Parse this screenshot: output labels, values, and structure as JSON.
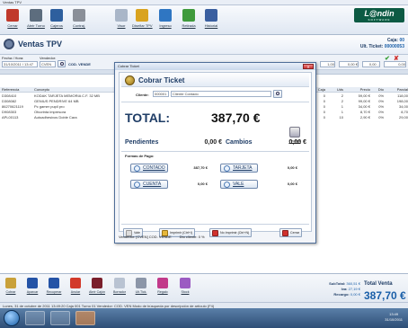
{
  "window": {
    "title": "Ventas TPV"
  },
  "toolbar": {
    "items": [
      {
        "label": "Cerrar",
        "icon": "red-circle-icon",
        "color": "#c0392b"
      },
      {
        "label": "Abrir Turno",
        "icon": "turn-icon",
        "color": "#5d6d7e"
      },
      {
        "label": "Cajeros",
        "icon": "cashier-icon",
        "color": "#2e5f9e"
      },
      {
        "label": "Contraj.",
        "icon": "person-icon",
        "color": "#8a8f98"
      },
      {
        "label": "Visor",
        "icon": "monitor-icon",
        "color": "#a9b6c8"
      },
      {
        "label": "Diseñar TPV",
        "icon": "design-icon",
        "color": "#d9a31f"
      },
      {
        "label": "Ingreso",
        "icon": "cash-in-icon",
        "color": "#2f76c2"
      },
      {
        "label": "Retirada",
        "icon": "cash-out-icon",
        "color": "#3f9a3c"
      },
      {
        "label": "Historial",
        "icon": "history-icon",
        "color": "#3a5fa0"
      }
    ]
  },
  "logo": {
    "text": "L@ndin",
    "sub": "SOFTWARE"
  },
  "header": {
    "title": "Ventas TPV",
    "caja_label": "Caja:",
    "caja_value": "00",
    "ticket_label": "Ult. Ticket:",
    "ticket_value": "00000053"
  },
  "filter": {
    "fecha_label": "Fecha / Hora:",
    "fecha_value": "31/10/2011 / 13:47",
    "vendedor_label": "Vendedor:",
    "vendedor_value": "CVEN",
    "cod_label": "COD. VENDE",
    "right_values": [
      "1,00",
      "0,00 €",
      "0,00 ..",
      "0,00"
    ]
  },
  "grid": {
    "headers": [
      "Referencia",
      "Concepto",
      "Caja",
      "Uds",
      "Precio",
      "Dto",
      "Parcial"
    ],
    "rows": [
      [
        "D308410",
        "KODAK TARJETA MEMORIA C.F. 32 MB",
        "0",
        "2",
        "59,00 €",
        "0%",
        "118,00"
      ],
      [
        "D308082",
        "GENIUS PENDRIVE 64 MB",
        "0",
        "2",
        "99,00 €",
        "0%",
        "198,00"
      ],
      [
        "86270621119",
        "Pc gamer pupil pro",
        "0",
        "1",
        "34,00 €",
        "0%",
        "34,00"
      ],
      [
        "D908303",
        "Ofcorinta impresora",
        "0",
        "1",
        "8,70 €",
        "0%",
        "8,70"
      ],
      [
        "APL00113",
        "Autoadhesivos Doble Cara",
        "0",
        "10",
        "2,90 €",
        "0%",
        "29,00"
      ]
    ]
  },
  "dialog": {
    "caption": "Cobrar Ticket",
    "title": "Cobrar Ticket",
    "cliente_label": "Cliente:",
    "cliente_code": "000001",
    "cliente_name": "Cliente Contado",
    "total_label": "TOTAL:",
    "total_value": "387,70 €",
    "fechas_label": "Fechas",
    "pendientes_label": "Pendientes",
    "pendientes_value": "0,00 €",
    "cambios_label": "Cambios",
    "cambios_value": "0,00 €",
    "formas_label": "Formas de Pago:",
    "payments": [
      {
        "label": "CONTADO",
        "value": "387,70 €"
      },
      {
        "label": "TARJETA",
        "value": "0,00 €"
      },
      {
        "label": "CUENTA",
        "value": "0,00 €"
      },
      {
        "label": "VALE",
        "value": "0,00 €"
      }
    ],
    "buttons": [
      "Vale",
      "Imprimir (Ctrl+I)",
      "No Imprimir (Ctrl+N)",
      "Cerrar"
    ],
    "footer_vendedor": "Vendedor: [CVEN] COD. VENDE",
    "footer_dto": "Dto cliente: 0 %"
  },
  "bottom": {
    "items": [
      {
        "label": "Cobrar",
        "icon": "coins-icon",
        "color": "#c9a13a"
      },
      {
        "label": "Aparcar",
        "icon": "park-icon",
        "color": "#2453a6"
      },
      {
        "label": "Recuperar",
        "icon": "recover-icon",
        "color": "#2453a6"
      },
      {
        "label": "Anular",
        "icon": "cancel-icon",
        "color": "#d23a2a"
      },
      {
        "label": "Abrir Cajón",
        "icon": "drawer-icon",
        "color": "#7a1f2b"
      },
      {
        "label": "Borrador",
        "icon": "draft-icon",
        "color": "#b9c3d2"
      },
      {
        "label": "Ult.Tick.",
        "icon": "last-ticket-icon",
        "color": "#8c96a8"
      },
      {
        "label": "Regalo",
        "icon": "gift-icon",
        "color": "#c23a8a"
      },
      {
        "label": "Stock",
        "icon": "stock-icon",
        "color": "#9b5bc2"
      }
    ],
    "subtotal_label": "SubTotal:",
    "subtotal_value": "360,51 €",
    "iva_label": "Iva:",
    "iva_value": "27,19 €",
    "recargo_label": "Recargo:",
    "recargo_value": "0,00 €",
    "total_label": "Total Venta",
    "total_value": "387,70 €"
  },
  "status": "Lunes, 31 de octubre de 2011   13:49:20   Caja 001   Turno 01   Vendedor: COD. VEN   Modo de búsqueda por descripción de artículo (F4)",
  "taskbar": {
    "time": "13:49",
    "date": "31/10/2011"
  }
}
